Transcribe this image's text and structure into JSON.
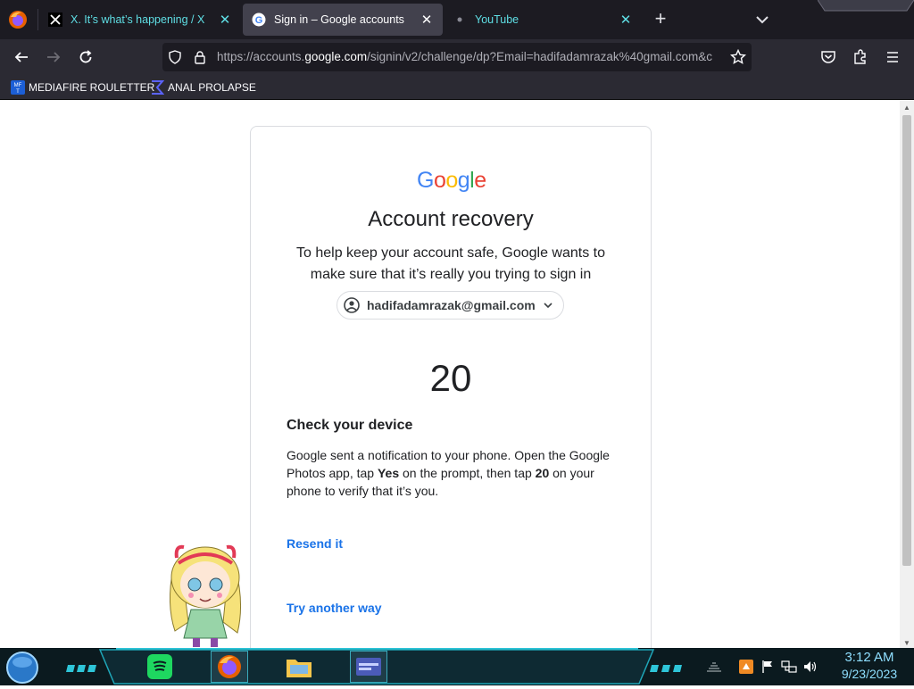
{
  "browser": {
    "tabs": [
      {
        "label": "X. It’s what’s happening / X",
        "icon": "x-logo-icon",
        "active": false
      },
      {
        "label": "Sign in – Google accounts",
        "icon": "google-g-icon",
        "active": true
      },
      {
        "label": "YouTube",
        "icon": "loading-dot-icon",
        "active": false
      }
    ],
    "url_prefix": "https://accounts.",
    "url_domain": "google.com",
    "url_suffix": "/signin/v2/challenge/dp?Email=hadifadamrazak%40gmail.com&c",
    "bookmarks": [
      {
        "label": "MEDIAFIRE ROULETTER",
        "icon": "mediafire-icon"
      },
      {
        "label": "ANAL PROLAPSE",
        "icon": "sigma-icon"
      }
    ]
  },
  "page": {
    "logo_text": "Google",
    "heading": "Account recovery",
    "subtext": "To help keep your account safe, Google wants to make sure that it’s really you trying to sign in",
    "account_email": "hadifadamrazak@gmail.com",
    "code": "20",
    "check_title": "Check your device",
    "instructions_part1": "Google sent a notification to your phone. Open the Google Photos app, tap ",
    "instructions_yes": "Yes",
    "instructions_part2": " on the prompt, then tap ",
    "instructions_code": "20",
    "instructions_part3": " on your phone to verify that it’s you.",
    "resend_label": "Resend it",
    "try_another_label": "Try another way"
  },
  "taskbar": {
    "apps": [
      "spotify-icon",
      "firefox-icon",
      "file-explorer-icon",
      "window-app-icon"
    ],
    "tray_icons": [
      "network-bars-icon",
      "app-tray-icon",
      "flag-icon",
      "network-icon",
      "volume-icon"
    ],
    "time": "3:12 AM",
    "date": "9/23/2023"
  },
  "colors": {
    "accent_tab_text": "#5fdfe5",
    "link_blue": "#1a73e8",
    "clock_text": "#8fdfff"
  }
}
